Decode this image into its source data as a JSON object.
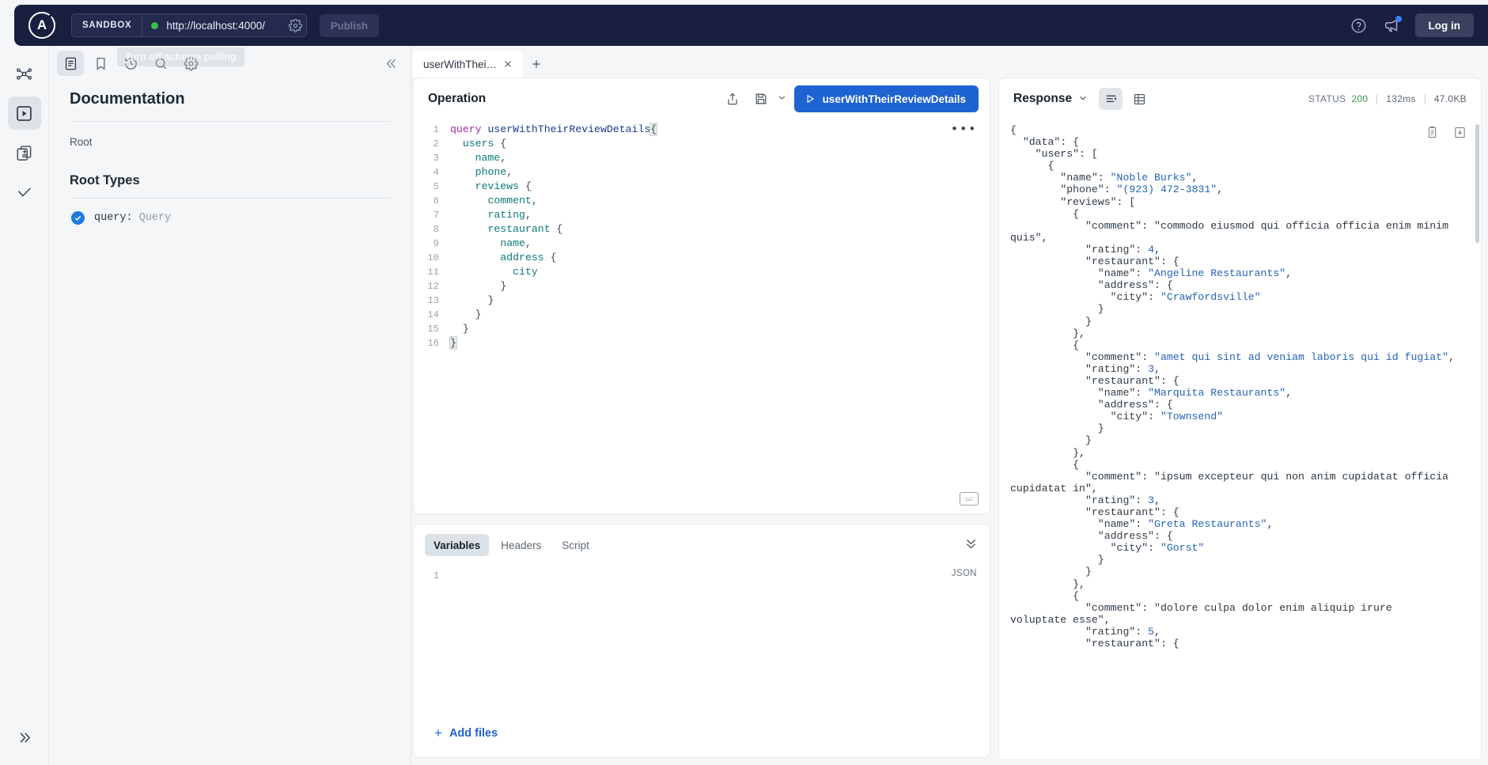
{
  "topbar": {
    "logo_alt": "apollo-logo",
    "sandbox_badge": "SANDBOX",
    "url_value": "http://localhost:4000/",
    "url_placeholder": "http://localhost:4000/",
    "connection_status": "connected",
    "settings_icon": "gear-icon",
    "publish_label": "Publish",
    "help_icon": "question-circle-icon",
    "announcement_icon": "megaphone-icon",
    "login_label": "Log in"
  },
  "rail": {
    "items": [
      {
        "name": "graph-icon",
        "label": "Graph"
      },
      {
        "name": "explorer-icon",
        "label": "Explorer",
        "active": true
      },
      {
        "name": "schema-icon",
        "label": "Schema"
      },
      {
        "name": "checks-icon",
        "label": "Checks"
      }
    ],
    "expand_icon": "chevron-double-right-icon"
  },
  "docs": {
    "toolbar": [
      {
        "name": "documentation-icon",
        "label": "Documentation",
        "active": true
      },
      {
        "name": "bookmark-icon",
        "label": "Saved operations"
      },
      {
        "name": "history-icon",
        "label": "History"
      },
      {
        "name": "search-icon",
        "label": "Search"
      },
      {
        "name": "settings-icon",
        "label": "Settings"
      }
    ],
    "collapse_icon": "chevron-double-left-icon",
    "tooltip": "Turn off schema polling",
    "title": "Documentation",
    "breadcrumb": "Root",
    "section_title": "Root Types",
    "root_types": [
      {
        "field": "query:",
        "type": "Query"
      }
    ]
  },
  "tabs": {
    "items": [
      {
        "label": "userWithThei…",
        "active": true
      }
    ],
    "close_icon": "close-icon",
    "new_tab_label": "+"
  },
  "operation": {
    "title": "Operation",
    "share_icon": "share-icon",
    "save_icon": "save-icon",
    "save_chevron": "chevron-down-icon",
    "run_label": "userWithTheirReviewDetails",
    "run_icon": "play-icon",
    "more_icon": "more-horizontal-icon",
    "keyboard_icon": "keyboard-icon",
    "code_lines": [
      {
        "n": 1,
        "text": "query userWithTheirReviewDetails{"
      },
      {
        "n": 2,
        "text": "  users {"
      },
      {
        "n": 3,
        "text": "    name,"
      },
      {
        "n": 4,
        "text": "    phone,"
      },
      {
        "n": 5,
        "text": "    reviews {"
      },
      {
        "n": 6,
        "text": "      comment,"
      },
      {
        "n": 7,
        "text": "      rating,"
      },
      {
        "n": 8,
        "text": "      restaurant {"
      },
      {
        "n": 9,
        "text": "        name,"
      },
      {
        "n": 10,
        "text": "        address {"
      },
      {
        "n": 11,
        "text": "          city"
      },
      {
        "n": 12,
        "text": "        }"
      },
      {
        "n": 13,
        "text": "      }"
      },
      {
        "n": 14,
        "text": "    }"
      },
      {
        "n": 15,
        "text": "  }"
      },
      {
        "n": 16,
        "text": "}"
      }
    ]
  },
  "variables": {
    "tabs": [
      {
        "label": "Variables",
        "active": true
      },
      {
        "label": "Headers",
        "active": false
      },
      {
        "label": "Script",
        "active": false
      }
    ],
    "collapse_icon": "chevron-double-down-icon",
    "line_number": "1",
    "format_label": "JSON",
    "add_files_label": "Add files",
    "add_files_icon": "plus-icon"
  },
  "response": {
    "title": "Response",
    "chevron_icon": "chevron-down-icon",
    "json_view_icon": "json-view-icon",
    "table_view_icon": "table-view-icon",
    "status_label": "STATUS",
    "status_code": "200",
    "duration": "132ms",
    "size": "47.0KB",
    "copy_icon": "copy-icon",
    "download_icon": "download-icon",
    "json_lines": [
      "{",
      "  \"data\": {",
      "    \"users\": [",
      "      {",
      "        \"name\": \"Noble Burks\",",
      "        \"phone\": \"(923) 472-3831\",",
      "        \"reviews\": [",
      "          {",
      "            \"comment\": \"commodo eiusmod qui officia officia enim minim",
      "quis\",",
      "            \"rating\": 4,",
      "            \"restaurant\": {",
      "              \"name\": \"Angeline Restaurants\",",
      "              \"address\": {",
      "                \"city\": \"Crawfordsville\"",
      "              }",
      "            }",
      "          },",
      "          {",
      "            \"comment\": \"amet qui sint ad veniam laboris qui id fugiat\",",
      "            \"rating\": 3,",
      "            \"restaurant\": {",
      "              \"name\": \"Marquita Restaurants\",",
      "              \"address\": {",
      "                \"city\": \"Townsend\"",
      "              }",
      "            }",
      "          },",
      "          {",
      "            \"comment\": \"ipsum excepteur qui non anim cupidatat officia",
      "cupidatat in\",",
      "            \"rating\": 3,",
      "            \"restaurant\": {",
      "              \"name\": \"Greta Restaurants\",",
      "              \"address\": {",
      "                \"city\": \"Gorst\"",
      "              }",
      "            }",
      "          },",
      "          {",
      "            \"comment\": \"dolore culpa dolor enim aliquip irure",
      "voluptate esse\",",
      "            \"rating\": 5,",
      "            \"restaurant\": {"
    ]
  },
  "colors": {
    "topbar_bg": "#191f3f",
    "accent_blue": "#1d63d1",
    "status_green": "#3a9a4e",
    "connection_dot": "#3fb950"
  }
}
